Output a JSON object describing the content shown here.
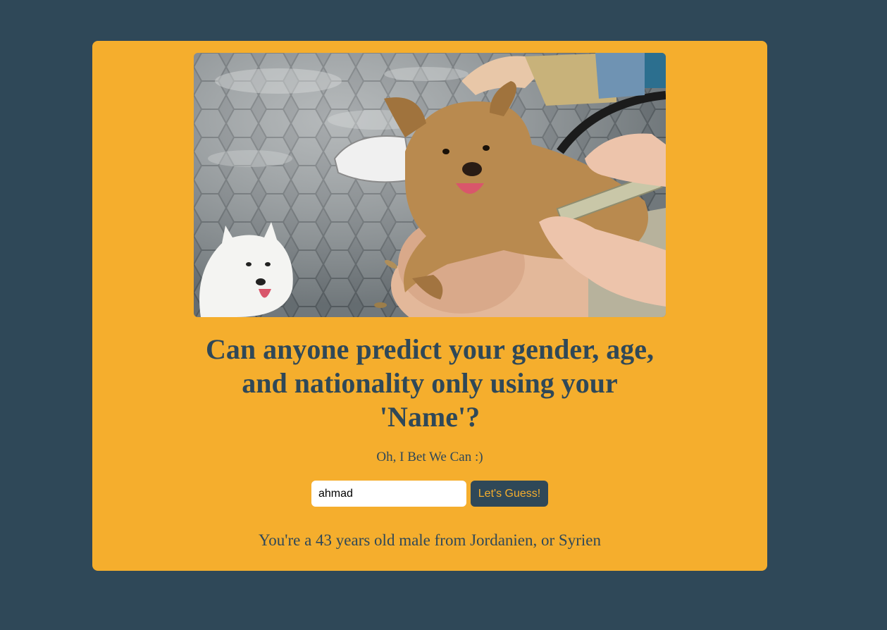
{
  "colors": {
    "page_background": "#2f4858",
    "card_background": "#f5ae2d",
    "text": "#2f4858",
    "button_background": "#2f4858",
    "button_text": "#f5ae2d"
  },
  "hero": {
    "image_description_icon": "dogs-photo"
  },
  "headline": "Can anyone predict your gender, age, and nationality only using your 'Name'?",
  "subtitle": "Oh, I Bet We Can :)",
  "form": {
    "input_value": "ahmad",
    "button_label": "Let's Guess!"
  },
  "result": "You're a 43 years old male from Jordanien, or Syrien"
}
